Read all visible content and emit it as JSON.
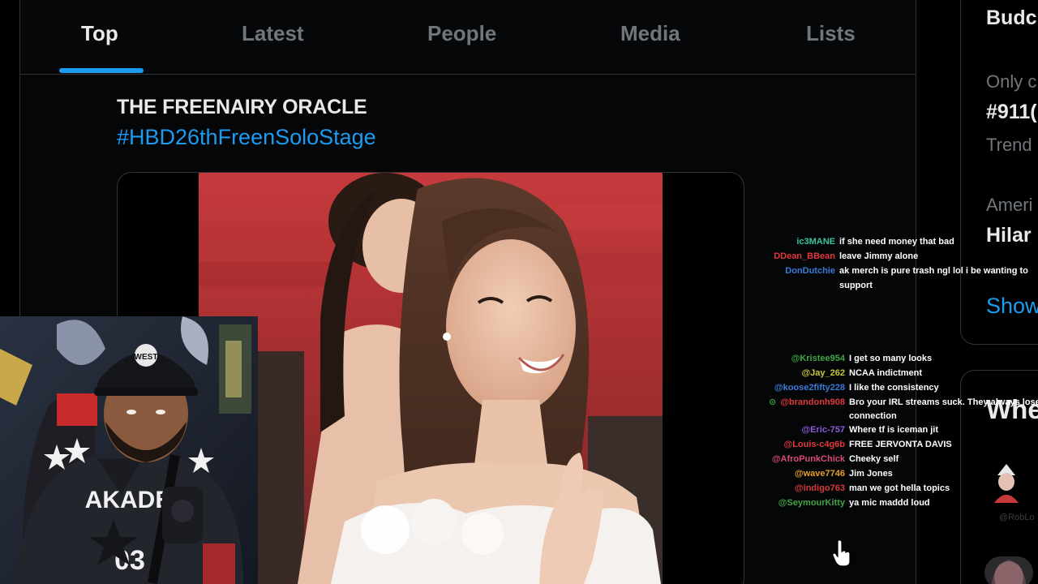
{
  "tabs": [
    {
      "label": "Top",
      "active": true
    },
    {
      "label": "Latest",
      "active": false
    },
    {
      "label": "People",
      "active": false
    },
    {
      "label": "Media",
      "active": false
    },
    {
      "label": "Lists",
      "active": false
    }
  ],
  "tweet": {
    "author": "THE FREENAIRY ORACLE",
    "hashtag": "#HBD26thFreenSoloStage"
  },
  "sidebar": {
    "title": "Budc",
    "trend1_context": "Only c",
    "trend1_name": "#911(",
    "trend1_meta": "Trend",
    "trend2_context": "Ameri",
    "trend2_name": "Hilar",
    "show_more": "Show",
    "who_to_follow": "Whe",
    "suggested_handle": "@RobLo"
  },
  "webcam": {
    "cap_text": "WEST",
    "jersey_text": "AKADE",
    "jersey_number": "03"
  },
  "chat": {
    "messages": [
      {
        "user": "ic3MANE",
        "text": "if she need money that bad",
        "color": "#3ac4a0"
      },
      {
        "user": "DDean_BBean",
        "text": "leave Jimmy alone",
        "color": "#e03a3a"
      },
      {
        "user": "DonDutchie",
        "text": "ak merch is pure trash ngl lol i be wanting to",
        "text2": "support",
        "color": "#3a7ad8"
      },
      {
        "user": "@Kristee954",
        "text": "I get so many looks",
        "color": "#3fa63f"
      },
      {
        "user": "@Jay_262",
        "text": "NCAA indictment",
        "color": "#c8c83a"
      },
      {
        "user": "@koose2fifty228",
        "text": "I like the consistency",
        "color": "#3a7ad8"
      },
      {
        "user": "@brandonh908",
        "text": "Bro your IRL streams suck. They always lose",
        "text2": "connection",
        "color": "#e03a3a",
        "badge": "⊙"
      },
      {
        "user": "@Eric-757",
        "text": "Where tf is iceman jit",
        "color": "#8a5ad8"
      },
      {
        "user": "@Louis-c4g6b",
        "text": "FREE JERVONTA DAVIS",
        "color": "#e03a3a"
      },
      {
        "user": "@AfroPunkChick",
        "text": "Cheeky self",
        "color": "#d84a7a"
      },
      {
        "user": "@wave7746",
        "text": "Jim Jones",
        "color": "#e8a02a"
      },
      {
        "user": "@indigo763",
        "text": "man we got hella topics",
        "color": "#d83a3a"
      },
      {
        "user": "@SeymourKitty",
        "text": "ya mic maddd loud",
        "color": "#3fa63f"
      }
    ]
  },
  "colors": {
    "accent": "#1d9bf0",
    "muted": "#71767b",
    "text": "#e7e9ea",
    "border": "#2f3336"
  }
}
